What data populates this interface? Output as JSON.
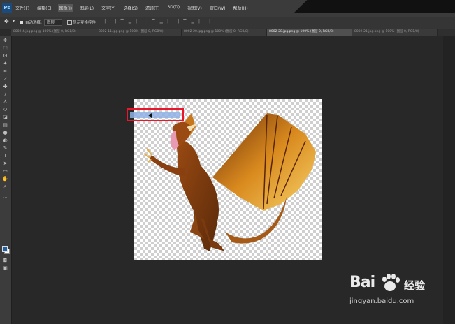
{
  "app": {
    "logo": "Ps",
    "menus": [
      "文件(F)",
      "编辑(E)",
      "图像(I)",
      "图层(L)",
      "文字(Y)",
      "选择(S)",
      "滤镜(T)",
      "3D(D)",
      "视图(V)",
      "窗口(W)",
      "帮助(H)"
    ],
    "active_menu_index": 2
  },
  "options_bar": {
    "auto_select_label": "自动选择:",
    "auto_select_value": "图层",
    "show_transform_label": "显示变换控件"
  },
  "tabs": [
    "8002-4.jpg.png @ 100% (图层 0, RGB/8)",
    "8002-11.jpg.png @ 100% (图层 0, RGB/8)",
    "8002-20.jpg.png @ 100% (图层 0, RGB/8)",
    "8002-28.jpg.png @ 100% (图层 0, RGB/8)",
    "8002-21.jpg.png @ 100% (图层 0, RGB/8)"
  ],
  "active_tab_index": 3,
  "watermark": {
    "brand": "Bai",
    "brand2": "经验",
    "url": "jingyan.baidu.com"
  },
  "colors": {
    "highlight_border": "#e8172c",
    "selection_fill": "#8fb2e6",
    "foreground": "#1f5fa8",
    "background": "#ffffff"
  }
}
